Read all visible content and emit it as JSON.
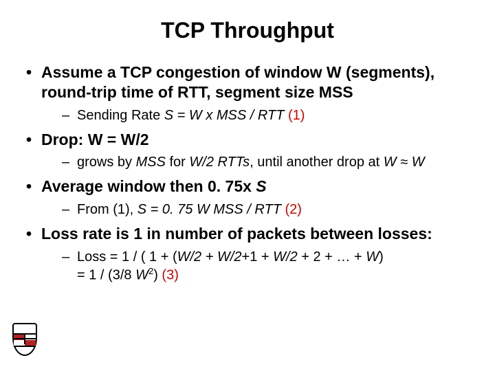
{
  "title": "TCP Throughput",
  "bullets": [
    {
      "text": "Assume a TCP congestion of window W (segments), round-trip time of RTT, segment size MSS",
      "subs": [
        {
          "prefix": "Sending Rate ",
          "italic": "S = W x MSS / RTT",
          "red": " (1)"
        }
      ]
    },
    {
      "text": "Drop: W = W/2",
      "subs": [
        {
          "prefix": "grows by ",
          "italic": "MSS",
          "mid": " for ",
          "italic2": "W/2 RTTs",
          "tail": ", until another drop at ",
          "italic3": "W ≈ W"
        }
      ]
    },
    {
      "text": "Average window then 0. 75x ",
      "italic_tail": "S",
      "subs": [
        {
          "leadspace": " ",
          "prefix": "From (1), ",
          "italic": "S = 0. 75 W MSS / RTT",
          "red": " (2)"
        }
      ]
    },
    {
      "text": "Loss rate is 1 in number of packets between losses:",
      "subs": [
        {
          "prefix": "Loss = 1 / ( 1 + (",
          "italic": "W/2 + W/2",
          "mid": "+1 + ",
          "italic2": "W/2",
          "mid2": " + 2  + … + ",
          "italic3": "W",
          "tail": ")",
          "line2_prefix": "= 1 / (3/8 ",
          "line2_italic": "W",
          "line2_sup": "2",
          "line2_tail": ")",
          "line2_red": " (3)"
        }
      ]
    }
  ]
}
